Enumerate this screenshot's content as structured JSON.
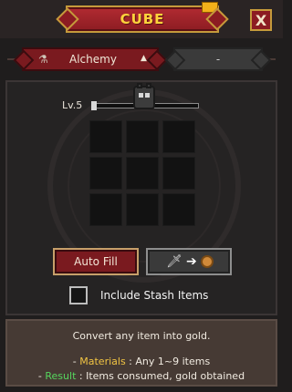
{
  "header": {
    "title": "CUBE",
    "close_label": "X"
  },
  "tabs": {
    "selected": "Alchemy",
    "secondary": "-"
  },
  "level": {
    "label": "Lv.5",
    "progress": 0.03
  },
  "buttons": {
    "autofill_label": "Auto Fill",
    "convert_icons": [
      "sword-icon",
      "arrow-icon",
      "coin-icon"
    ]
  },
  "stash": {
    "label": "Include Stash Items",
    "checked": false
  },
  "info": {
    "line1": "Convert any item into gold.",
    "materials_prefix": "- ",
    "materials_label": "Materials",
    "materials_text": " : Any 1~9 items",
    "result_prefix": "- ",
    "result_label": "Result",
    "result_text": " : Items consumed, gold obtained"
  },
  "colors": {
    "accent_red": "#7a1a1f",
    "gold": "#f1c443",
    "green": "#56d65e"
  }
}
